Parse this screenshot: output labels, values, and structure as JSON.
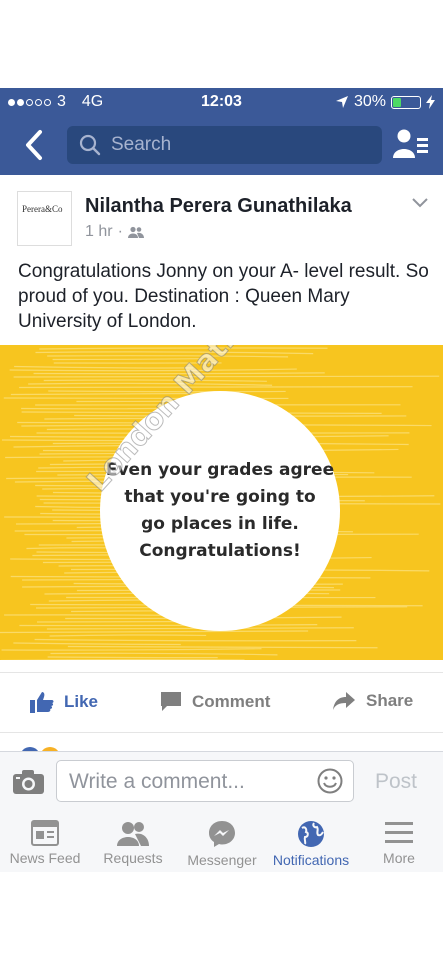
{
  "status_bar": {
    "carrier": "3",
    "network": "4G",
    "time": "12:03",
    "battery": "30%",
    "battery_level": 0.3
  },
  "nav": {
    "search_placeholder": "Search"
  },
  "post": {
    "author": "Nilantha Perera Gunathilaka",
    "time": "1 hr",
    "separator": "·",
    "avatar_logo": "Perera&Co",
    "message": "Congratulations Jonny on your A- level result. So proud of you. Destination : Queen Mary University of London.",
    "image": {
      "quote_lines": [
        "Even your grades agree",
        "that you're going to",
        "go places in life.",
        "Congratulations!"
      ],
      "watermark": "London Maths Tutors",
      "colors": {
        "background": "#f7c51f",
        "circle": "#ffffff"
      }
    },
    "actions": {
      "like": "Like",
      "comment": "Comment",
      "share": "Share"
    }
  },
  "comment_bar": {
    "placeholder": "Write a comment...",
    "post_label": "Post"
  },
  "tabs": [
    {
      "label": "News Feed",
      "icon": "news-feed-icon",
      "active": false
    },
    {
      "label": "Requests",
      "icon": "friend-requests-icon",
      "active": false
    },
    {
      "label": "Messenger",
      "icon": "messenger-icon",
      "active": false
    },
    {
      "label": "Notifications",
      "icon": "globe-icon",
      "active": true
    },
    {
      "label": "More",
      "icon": "menu-icon",
      "active": false
    }
  ],
  "colors": {
    "brand": "#3b5998",
    "accent": "#4267b2"
  }
}
